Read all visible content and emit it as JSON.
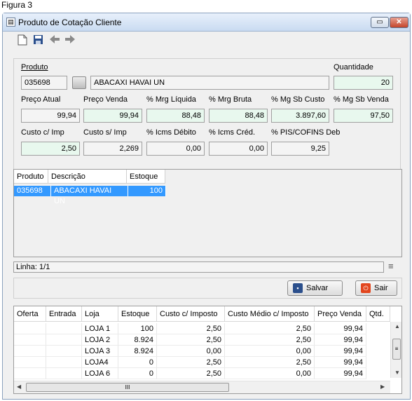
{
  "figure_caption": "Figura 3",
  "window": {
    "title": "Produto de Cotação Cliente"
  },
  "toolbar": {
    "icons": [
      "new-document-icon",
      "save-disk-icon",
      "arrow-left-icon",
      "arrow-right-icon"
    ]
  },
  "produto": {
    "label": "Produto",
    "code": "035698",
    "description": "ABACAXI HAVAI UN",
    "quantidade_label": "Quantidade",
    "quantidade": "20"
  },
  "row1": {
    "labels": [
      "Preço Atual",
      "Preço Venda",
      "% Mrg Líquida",
      "% Mrg Bruta",
      "% Mg Sb Custo",
      "% Mg Sb Venda"
    ],
    "values": [
      "99,94",
      "99,94",
      "88,48",
      "88,48",
      "3.897,60",
      "97,50"
    ]
  },
  "row2": {
    "labels": [
      "Custo c/ Imp",
      "Custo s/ Imp",
      "% Icms Débito",
      "% Icms Créd.",
      "% PIS/COFINS Deb"
    ],
    "values": [
      "2,50",
      "2,269",
      "0,00",
      "0,00",
      "9,25"
    ]
  },
  "grid1": {
    "headers": [
      "Produto",
      "Descrição",
      "Estoque"
    ],
    "row": [
      "035698",
      "ABACAXI HAVAI UN",
      "100"
    ]
  },
  "linha": "Linha: 1/1",
  "buttons": {
    "salvar": "Salvar",
    "sair": "Sair"
  },
  "grid2": {
    "headers": [
      "Oferta",
      "Entrada",
      "Loja",
      "Estoque",
      "Custo c/ Imposto",
      "Custo Médio c/ Imposto",
      "Preço Venda",
      "Qtd."
    ],
    "rows": [
      [
        "",
        "",
        "LOJA 1",
        "100",
        "2,50",
        "2,50",
        "99,94"
      ],
      [
        "",
        "",
        "LOJA 2",
        "8.924",
        "2,50",
        "2,50",
        "99,94"
      ],
      [
        "",
        "",
        "LOJA 3",
        "8.924",
        "0,00",
        "0,00",
        "99,94"
      ],
      [
        "",
        "",
        "LOJA4",
        "0",
        "2,50",
        "2,50",
        "99,94"
      ],
      [
        "",
        "",
        "LOJA 6",
        "0",
        "2,50",
        "0,00",
        "99,94"
      ]
    ],
    "hscroll_glyph": "III"
  }
}
